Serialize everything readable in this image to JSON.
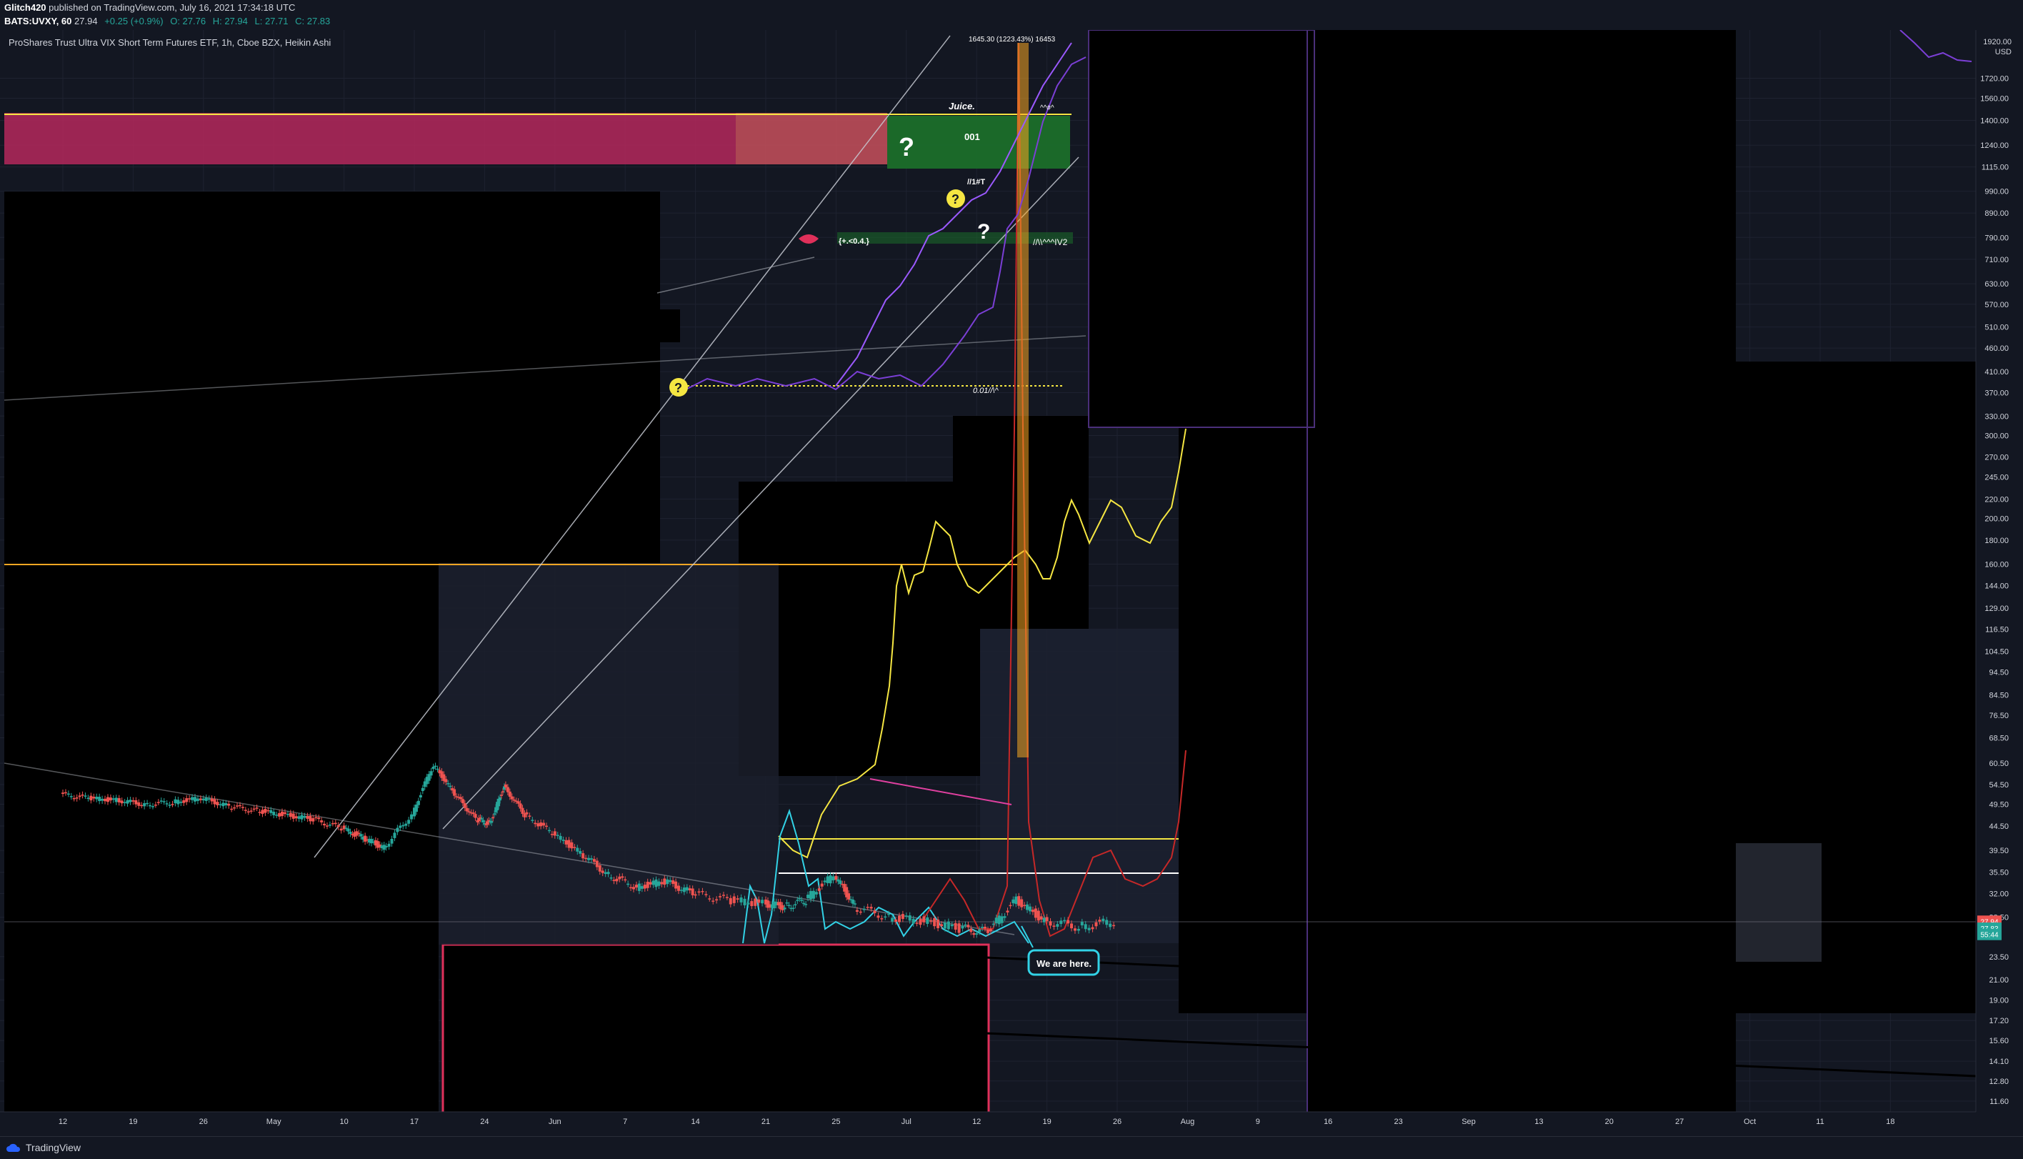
{
  "header": {
    "author": "Glitch420",
    "published_text": "published on TradingView.com, July 16, 2021 17:34:18 UTC",
    "symbol_line": "BATS:UVXY, 60",
    "last": "27.94",
    "change": "+0.25 (+0.9%)",
    "open": "O: 27.76",
    "high": "H: 27.94",
    "low": "L: 27.71",
    "close": "C: 27.83"
  },
  "legend": {
    "title": "ProShares Trust Ultra VIX Short Term Futures ETF, 1h, Cboe BZX, Heikin Ashi"
  },
  "footer": {
    "brand": "TradingView"
  },
  "colors": {
    "background": "#131722",
    "up_candle": "#26a69a",
    "down_candle": "#ef5350",
    "accent_yellow": "#f5e642",
    "accent_cyan": "#32d2e6",
    "accent_red": "#c62828",
    "accent_purple": "#7b3fd6",
    "pink_zone": "#b5285c",
    "green_zone": "#1b6e2a",
    "orange_line": "#f5a623"
  },
  "chart_data": {
    "type": "candlestick",
    "title": "ProShares Trust Ultra VIX Short Term Futures ETF, 1h, Cboe BZX, Heikin Ashi",
    "y_scale": "log",
    "y_unit": "USD",
    "y_ticks": [
      "1920.00",
      "1720.00",
      "1560.00",
      "1400.00",
      "1240.00",
      "1115.00",
      "990.00",
      "890.00",
      "790.00",
      "710.00",
      "630.00",
      "570.00",
      "510.00",
      "460.00",
      "410.00",
      "370.00",
      "330.00",
      "300.00",
      "270.00",
      "245.00",
      "220.00",
      "200.00",
      "180.00",
      "160.00",
      "144.00",
      "129.00",
      "116.50",
      "104.50",
      "94.50",
      "84.50",
      "76.50",
      "68.50",
      "60.50",
      "54.50",
      "49.50",
      "44.50",
      "39.50",
      "35.50",
      "32.00",
      "28.50",
      "23.50",
      "21.00",
      "19.00",
      "17.20",
      "15.60",
      "14.10",
      "12.80",
      "11.60"
    ],
    "price_labels": [
      {
        "text": "27.94",
        "color": "#ef5350",
        "value": 27.94
      },
      {
        "text": "27.83",
        "color": "#26a69a",
        "value": 27.0
      },
      {
        "text": "55:44",
        "color": "#26a69a",
        "value": 26.2
      }
    ],
    "x_ticks": [
      "12",
      "19",
      "26",
      "May",
      "10",
      "17",
      "24",
      "Jun",
      "7",
      "14",
      "21",
      "25",
      "Jul",
      "12",
      "19",
      "26",
      "Aug",
      "9",
      "16",
      "23",
      "Sep",
      "13",
      "20",
      "27",
      "Oct",
      "11",
      "18"
    ],
    "series": [
      {
        "name": "UVXY",
        "kind": "heikin-ashi",
        "points": [
          [
            0,
            52
          ],
          [
            0.4,
            51
          ],
          [
            0.8,
            50.5
          ],
          [
            1.2,
            49.5
          ],
          [
            1.6,
            50
          ],
          [
            2,
            51
          ],
          [
            2.4,
            49
          ],
          [
            2.8,
            48
          ],
          [
            3.2,
            47
          ],
          [
            3.6,
            46
          ],
          [
            4,
            44
          ],
          [
            4.3,
            42
          ],
          [
            4.6,
            40
          ],
          [
            5,
            47
          ],
          [
            5.3,
            60
          ],
          [
            5.6,
            52
          ],
          [
            5.9,
            46
          ],
          [
            6.1,
            45
          ],
          [
            6.3,
            54
          ],
          [
            6.6,
            47
          ],
          [
            7,
            43
          ],
          [
            7.4,
            39
          ],
          [
            7.8,
            35
          ],
          [
            8.2,
            33
          ],
          [
            8.6,
            34
          ],
          [
            9,
            32
          ],
          [
            9.5,
            31
          ],
          [
            10,
            30.5
          ],
          [
            10.3,
            30
          ],
          [
            10.6,
            31
          ],
          [
            11,
            35
          ],
          [
            11.3,
            30
          ],
          [
            11.8,
            28.5
          ],
          [
            12.3,
            28
          ],
          [
            12.8,
            27
          ],
          [
            13.2,
            26.5
          ],
          [
            13.6,
            31
          ],
          [
            14,
            28
          ],
          [
            14.5,
            27.2
          ],
          [
            15,
            27.9
          ]
        ]
      }
    ],
    "annotations": [
      "Juice.",
      "001",
      "We are here.",
      "1645.30 (1223.43%) 16453",
      "//1#T",
      "//\\\\^^^IV2",
      "0.01//\\^",
      "{+.<0.4.}",
      "?",
      "?",
      "?",
      "?"
    ]
  },
  "annotations": {
    "juice": "Juice.",
    "zone_001": "001",
    "target_text": "1645.30 (1223.43%) 16453",
    "note_a": "//1#T",
    "note_b": "//\\\\^^^IV2",
    "note_c": "0.01//\\^",
    "note_d": "{+.<0.4.}",
    "we_are_here": "We are here.",
    "question": "?",
    "note_e": "^^#^"
  }
}
